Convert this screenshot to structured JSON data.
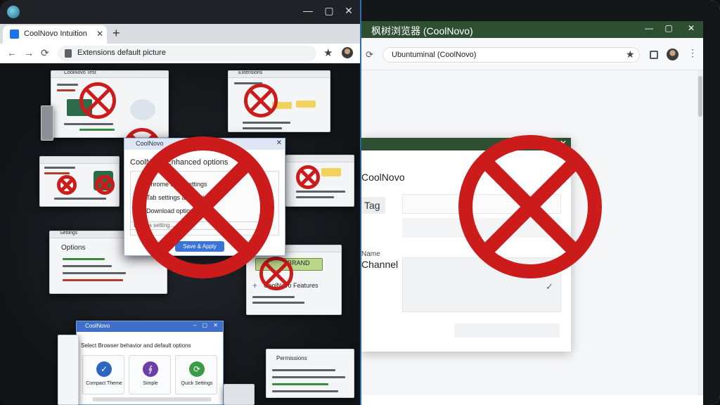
{
  "left_window": {
    "controls": {
      "minimize": "—",
      "maximize": "▢",
      "close": "✕"
    },
    "tab": {
      "title": "CoolNovo Intuition",
      "close": "✕",
      "new_tab": "+"
    },
    "toolbar": {
      "back": "←",
      "forward": "→",
      "reload": "⟳",
      "address": "Extensions default picture",
      "star": "★"
    },
    "dialog": {
      "title": "CoolNovo",
      "close": "✕",
      "heading": "CoolNovo Enhanced options",
      "rows": [
        "Chrome sync settings",
        "Tab settings and options",
        "Download options"
      ],
      "field_placeholder": "Enter a setting...",
      "button": "Save & Apply"
    },
    "bottom_panel": {
      "title": "CoolNovo",
      "controls": "– ▢ ✕",
      "heading": "Select Browser behavior and default options",
      "options": [
        {
          "icon": "✓",
          "label": "Compact Theme",
          "color": "#2a66c2"
        },
        {
          "icon": "∮",
          "label": "Simple",
          "color": "#6b3fa8"
        },
        {
          "icon": "⟳",
          "label": "Quick Settings",
          "color": "#3a9a45"
        }
      ]
    },
    "mini_labels": [
      "CoolNovo Test",
      "Extensions",
      "Settings",
      "Options",
      "CoolNovo Features",
      "Permissions"
    ],
    "mini_badge": "BRAND",
    "mini_plus": "+"
  },
  "right_window": {
    "title": "枫树浏览器 (CoolNovo)",
    "controls": {
      "minimize": "—",
      "maximize": "▢",
      "close": "✕"
    },
    "toolbar": {
      "reload": "⟳",
      "address": "Ubuntuminal (CoolNovo)",
      "star": "★",
      "menu": "⋮"
    },
    "dialog": {
      "close": "✕",
      "name": "CoolNovo",
      "tag_button": "Tag",
      "small_label": "Name",
      "label": "Channel",
      "check": "✓"
    }
  },
  "colors": {
    "prohibit_red": "#cc1b1b",
    "right_accent": "#2f4f33",
    "left_accent": "#3f6fc9"
  }
}
